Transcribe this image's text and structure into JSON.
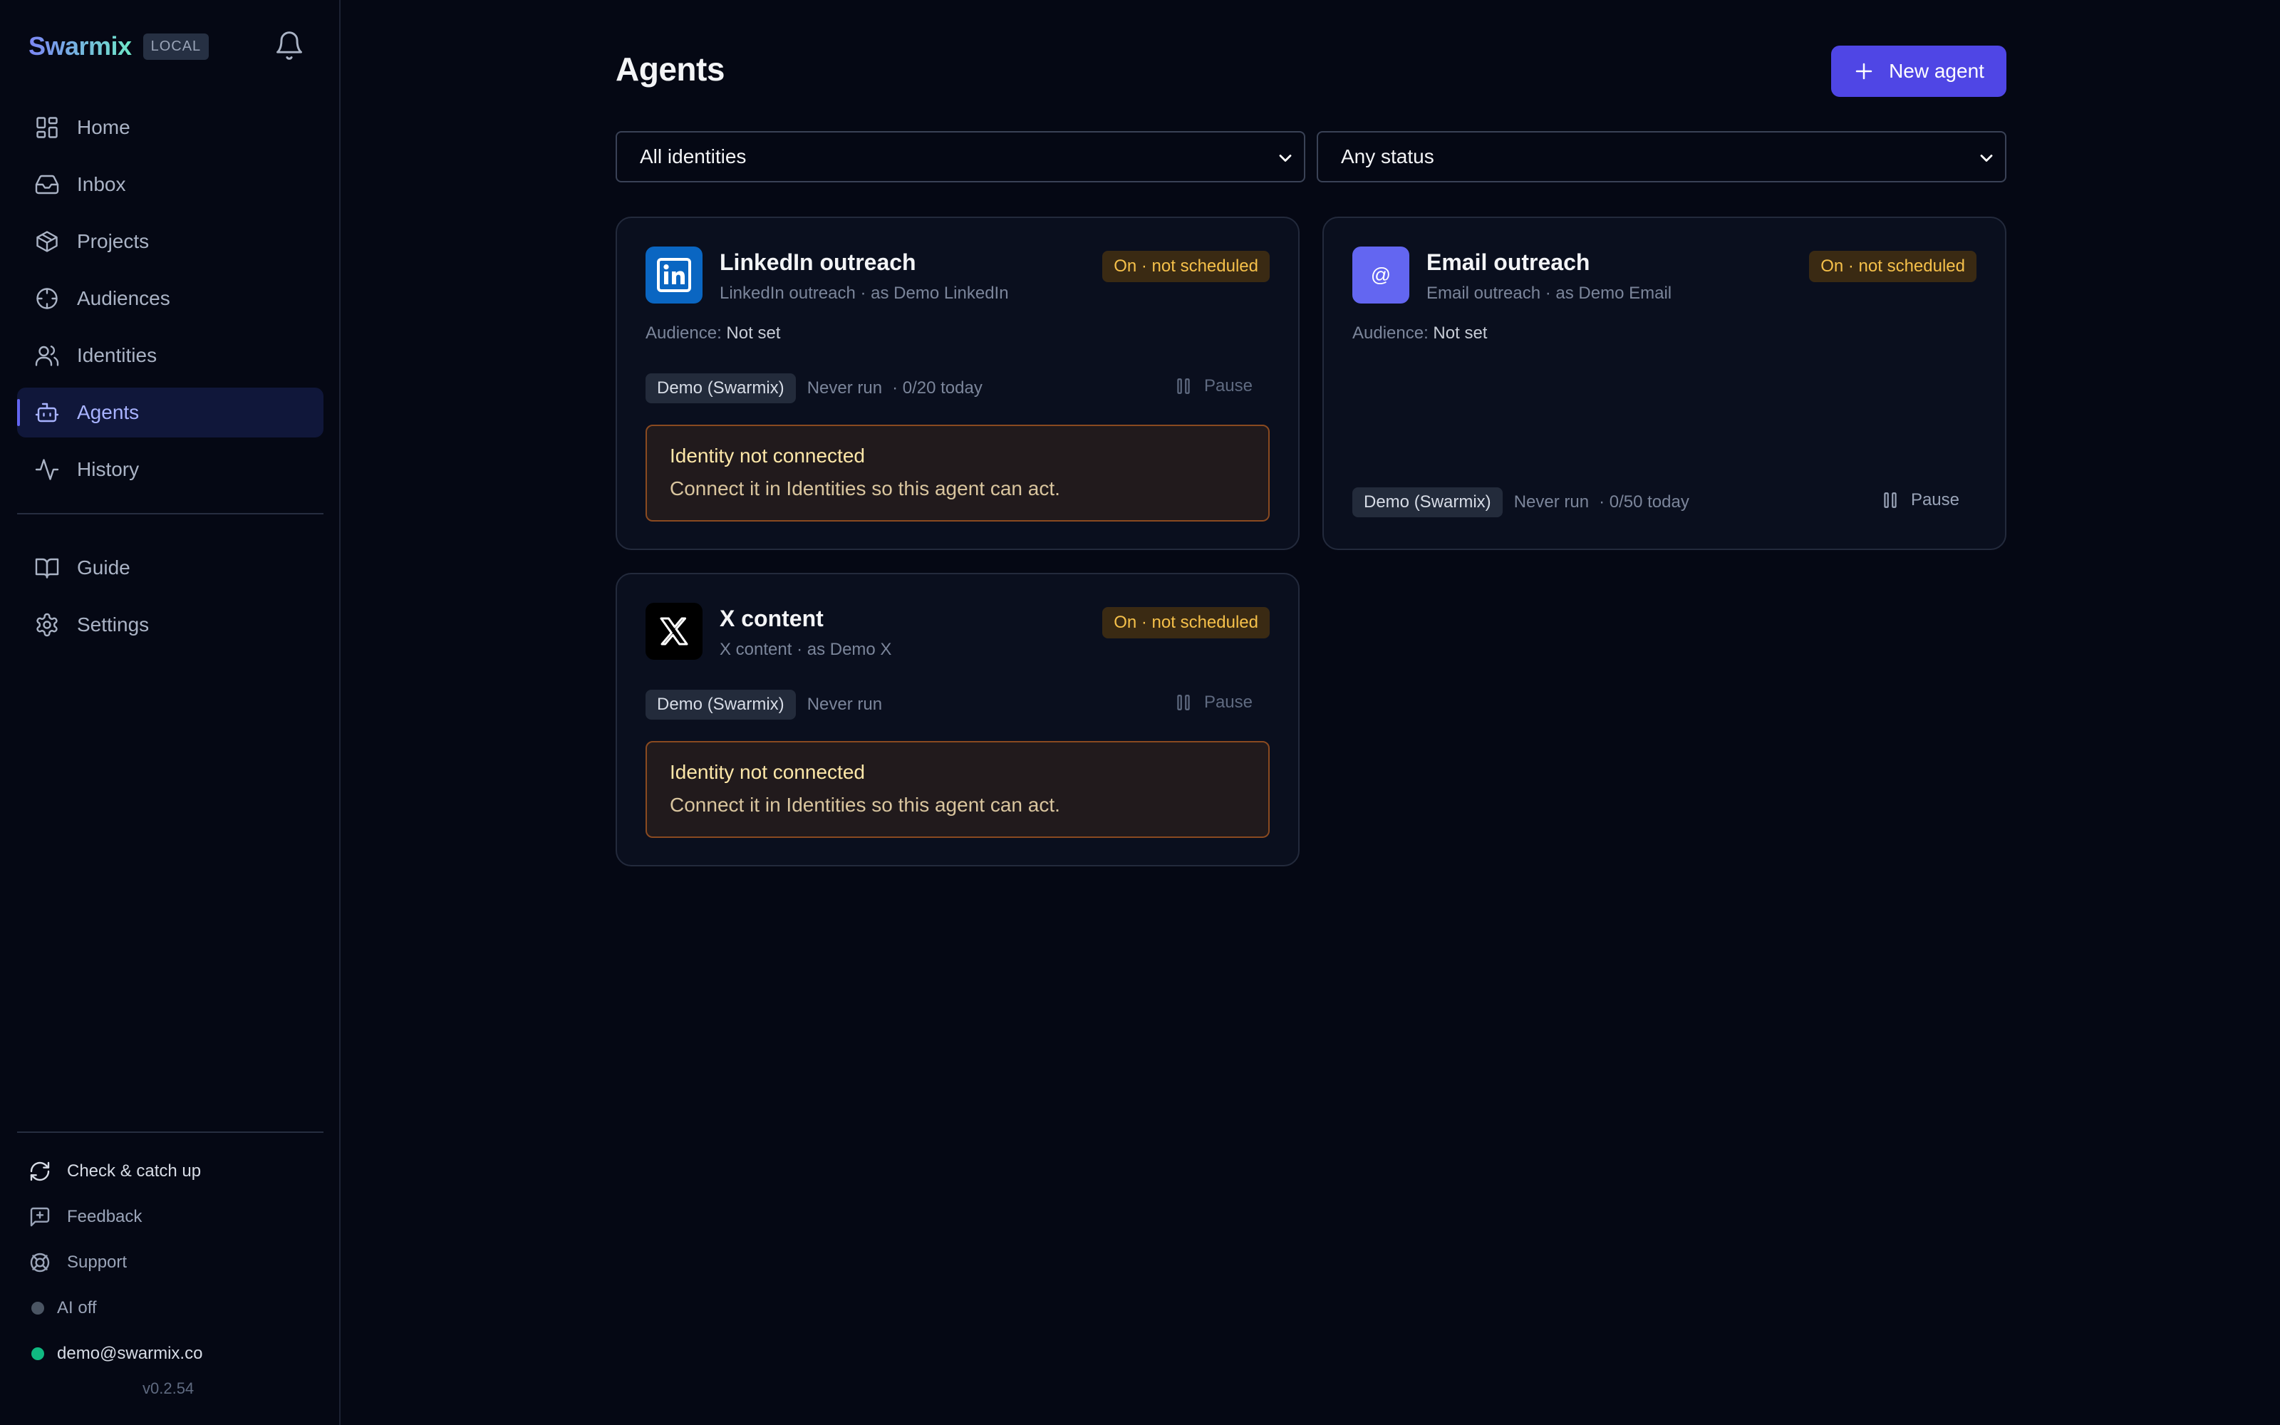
{
  "sidebar": {
    "brand": "Swarmix",
    "badge": "LOCAL",
    "nav": [
      {
        "label": "Home",
        "icon": "home-grid-icon"
      },
      {
        "label": "Inbox",
        "icon": "inbox-icon"
      },
      {
        "label": "Projects",
        "icon": "box-icon"
      },
      {
        "label": "Audiences",
        "icon": "crosshair-icon"
      },
      {
        "label": "Identities",
        "icon": "users-icon"
      },
      {
        "label": "Agents",
        "icon": "bot-icon",
        "active": true
      },
      {
        "label": "History",
        "icon": "activity-icon"
      }
    ],
    "secondary": [
      {
        "label": "Guide",
        "icon": "book-icon"
      },
      {
        "label": "Settings",
        "icon": "gear-icon"
      }
    ],
    "footer": {
      "check": "Check & catch up",
      "feedback": "Feedback",
      "support": "Support",
      "ai": "AI off",
      "account": "demo@swarmix.co",
      "version": "v0.2.54"
    }
  },
  "page": {
    "title": "Agents",
    "new_button": "New agent",
    "filters": {
      "identity": "All identities",
      "status": "Any status"
    }
  },
  "agents": [
    {
      "name": "LinkedIn outreach",
      "subtitle": "LinkedIn outreach · as Demo LinkedIn",
      "status": "On · not scheduled",
      "audience_label": "Audience:",
      "audience_value": "Not set",
      "chip": "Demo (Swarmix)",
      "last_run": "Never run",
      "quota": "· 0/20 today",
      "pause": "Pause",
      "warning_title": "Identity not connected",
      "warning_desc": "Connect it in Identities so this agent can act."
    },
    {
      "name": "Email outreach",
      "subtitle": "Email outreach · as Demo Email",
      "status": "On · not scheduled",
      "audience_label": "Audience:",
      "audience_value": "Not set",
      "chip": "Demo (Swarmix)",
      "last_run": "Never run",
      "quota": "· 0/50 today",
      "pause": "Pause"
    },
    {
      "name": "X content",
      "subtitle": "X content · as Demo X",
      "status": "On · not scheduled",
      "chip": "Demo (Swarmix)",
      "last_run": "Never run",
      "pause": "Pause",
      "warning_title": "Identity not connected",
      "warning_desc": "Connect it in Identities so this agent can act."
    }
  ],
  "colors": {
    "accent": "#4f46e5",
    "status_text": "#f5c04a",
    "status_bg": "#3a2a13",
    "ai_off_dot": "#4b5563",
    "online_dot": "#10b981"
  }
}
